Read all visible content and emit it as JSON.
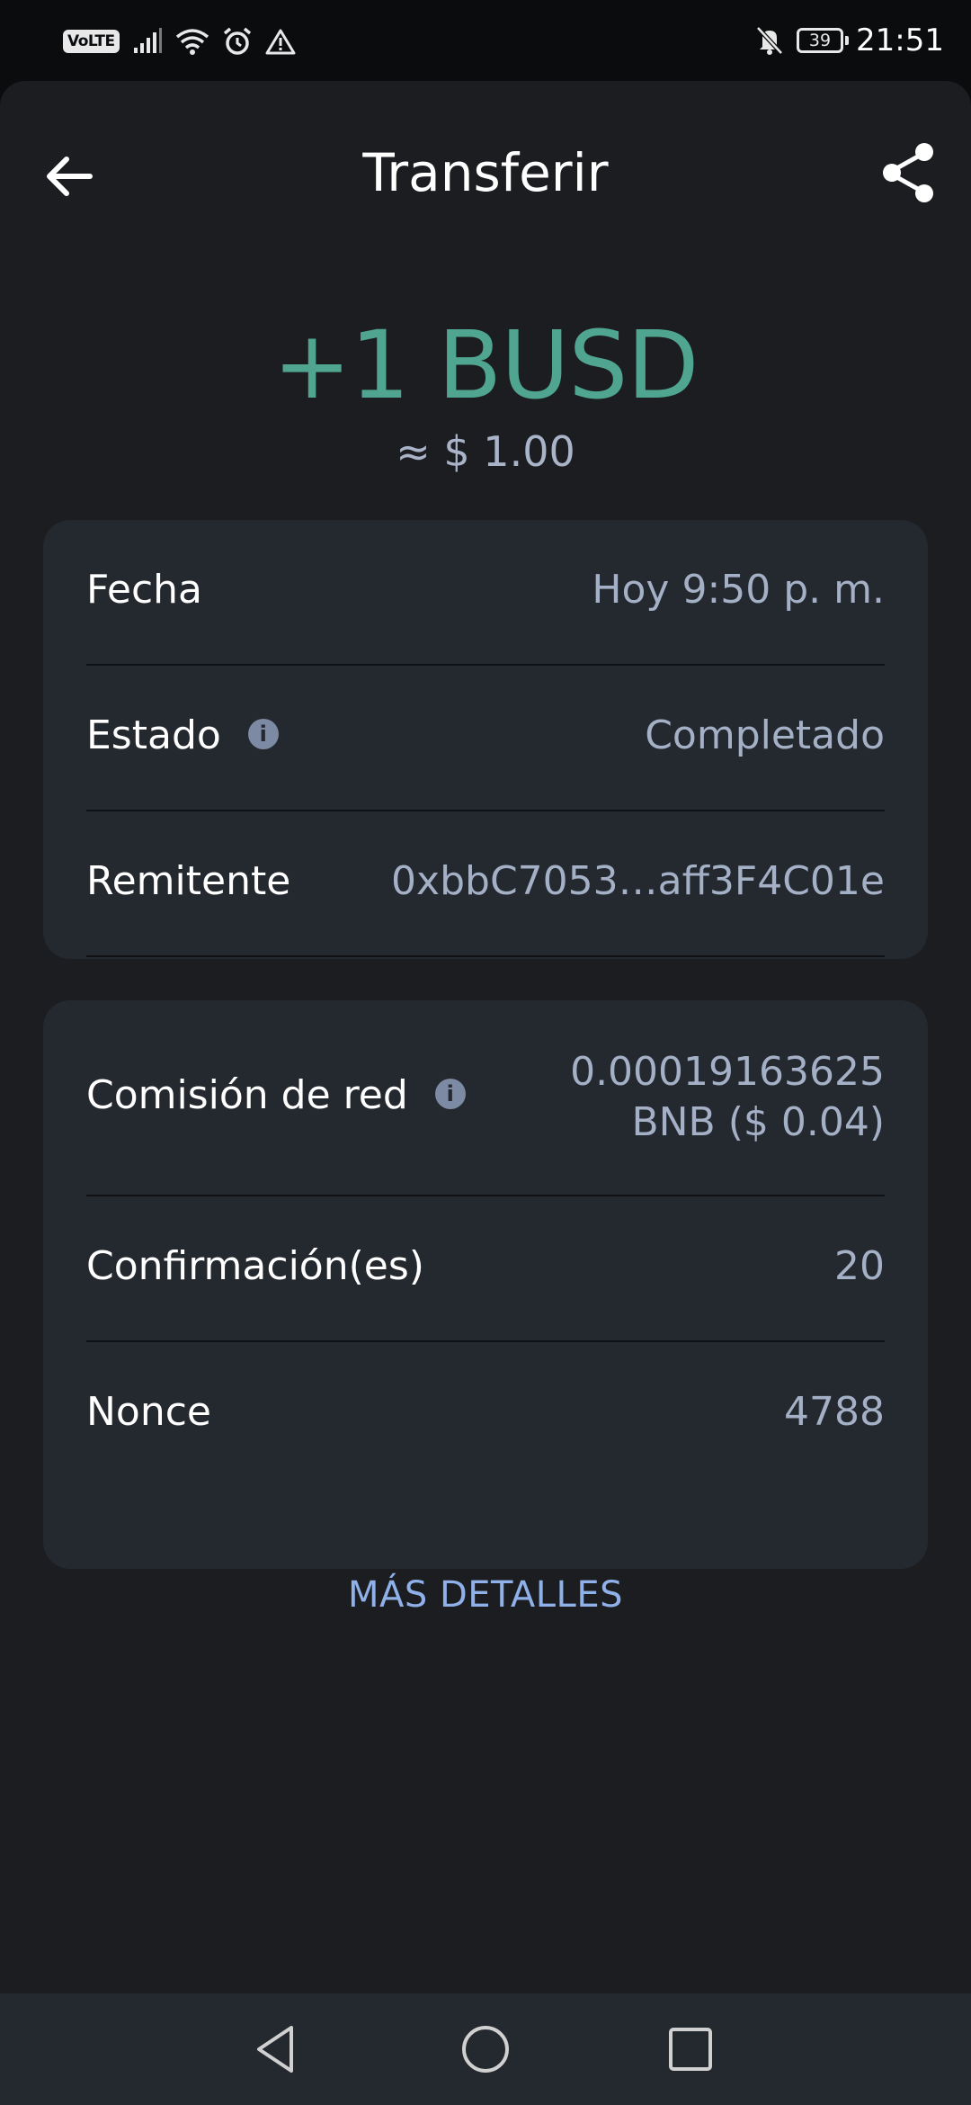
{
  "status_bar": {
    "volte": "VoLTE",
    "battery": "39",
    "time": "21:51"
  },
  "header": {
    "title": "Transferir"
  },
  "summary": {
    "amount": "+1 BUSD",
    "fiat": "≈ $ 1.00",
    "amount_color": "#4fa58f"
  },
  "details": [
    {
      "label": "Fecha",
      "value": "Hoy 9:50 p. m."
    },
    {
      "label": "Estado",
      "value": "Completado"
    },
    {
      "label": "Remitente",
      "value": "0xbbC7053…aff3F4C01e"
    }
  ],
  "fees": {
    "network_fee_label": "Comisión de red",
    "network_fee_line1": "0.00019163625",
    "network_fee_line2": "BNB ($ 0.04)",
    "confirmations_label": "Confirmación(es)",
    "confirmations_value": "20",
    "nonce_label": "Nonce",
    "nonce_value": "4788"
  },
  "more_details_label": "MÁS DETALLES"
}
